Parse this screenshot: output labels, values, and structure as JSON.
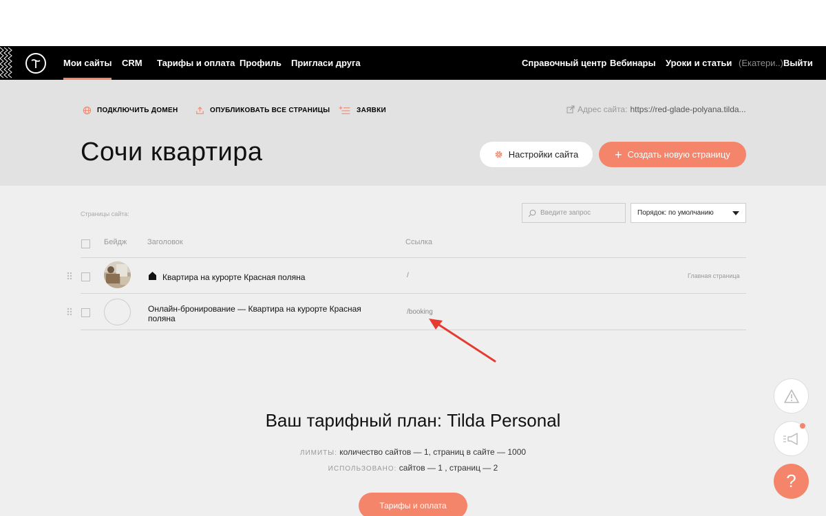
{
  "navbar": {
    "items": [
      "Мои сайты",
      "CRM",
      "Тарифы и оплата",
      "Профиль",
      "Пригласи друга"
    ],
    "right_items": [
      "Справочный центр",
      "Вебинары",
      "Уроки и статьи"
    ],
    "user": "(Екатери..)",
    "logout": "Выйти",
    "accent": "#f4846a"
  },
  "toolbar": {
    "connect_domain": "ПОДКЛЮЧИТЬ ДОМЕН",
    "publish_all": "ОПУБЛИКОВАТЬ ВСЕ СТРАНИЦЫ",
    "requests": "ЗАЯВКИ",
    "site_address_label": "Адрес сайта:",
    "site_address_url": "https://red-glade-polyana.tilda..."
  },
  "site": {
    "title": "Сочи квартира",
    "settings_button": "Настройки сайта",
    "create_button": "Создать новую страницу"
  },
  "pages": {
    "label": "Страницы сайта:",
    "search_placeholder": "Введите запрос",
    "order": "Порядок: по умолчанию",
    "columns": {
      "badge": "Бейдж",
      "title": "Заголовок",
      "link": "Ссылка"
    },
    "rows": [
      {
        "title": "Квартира на курорте Красная поляна",
        "link": "/",
        "tag": "Главная страница",
        "home_icon": "home-icon"
      },
      {
        "title_line1": "Онлайн-бронирование — Квартира на курорте Красная",
        "title_line2": "поляна",
        "link": "/booking",
        "tag": ""
      }
    ]
  },
  "plan": {
    "title": "Ваш тарифный план: Tilda Personal",
    "limits_cap": "ЛИМИТЫ:",
    "limits_text": "количество сайтов — 1, страниц в сайте — 1000",
    "used_cap": "ИСПОЛЬЗОВАНО:",
    "used_text": "сайтов — 1 , страниц — 2",
    "button": "Тарифы и оплата"
  },
  "fab": {
    "help": "?"
  },
  "annotation": {
    "arrow_color": "#e53b30"
  }
}
